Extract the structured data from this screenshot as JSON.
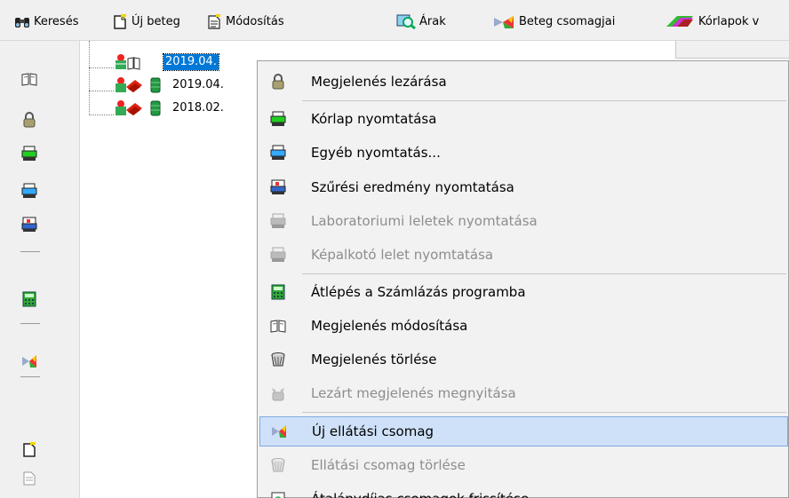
{
  "toolbar": {
    "items": [
      {
        "label": "Keresés",
        "icon": "binoculars-icon"
      },
      {
        "label": "Új beteg",
        "icon": "new-document-icon"
      },
      {
        "label": "Módosítás",
        "icon": "edit-document-icon"
      },
      {
        "label": "Árak",
        "icon": "price-search-icon"
      },
      {
        "label": "Beteg csomagjai",
        "icon": "package-icon"
      },
      {
        "label": "Kórlapok v",
        "icon": "records-icon"
      }
    ]
  },
  "tree": {
    "nodes": [
      {
        "label": "2019.04.",
        "selected": true
      },
      {
        "label": "2019.04.",
        "selected": false
      },
      {
        "label": "2018.02.",
        "selected": false
      }
    ]
  },
  "menu": {
    "items": [
      {
        "label": "Megjelenés lezárása",
        "icon": "lock-icon",
        "disabled": false
      },
      {
        "label": "Kórlap nyomtatása",
        "icon": "printer-green-icon",
        "disabled": false
      },
      {
        "label": "Egyéb nyomtatás...",
        "icon": "printer-blue-icon",
        "disabled": false
      },
      {
        "label": "Szűrési eredmény nyomtatása",
        "icon": "printer-screening-icon",
        "disabled": false
      },
      {
        "label": "Laboratoriumi leletek nyomtatása",
        "icon": "printer-gray-icon",
        "disabled": true
      },
      {
        "label": "Képalkotó lelet nyomtatása",
        "icon": "printer-gray-icon",
        "disabled": true
      },
      {
        "label": "Átlépés a Számlázás programba",
        "icon": "calculator-icon",
        "disabled": false
      },
      {
        "label": "Megjelenés módosítása",
        "icon": "book-icon",
        "disabled": false
      },
      {
        "label": "Megjelenés törlése",
        "icon": "wastebasket-icon",
        "disabled": false
      },
      {
        "label": "Lezárt megjelenés megnyitása",
        "icon": "unlock-icon",
        "disabled": true
      },
      {
        "label": "Új ellátási csomag",
        "icon": "package-icon",
        "disabled": false,
        "hover": true
      },
      {
        "label": "Ellátási csomag törlése",
        "icon": "wastebasket-icon",
        "disabled": true
      },
      {
        "label": "Átalánydíjas csomagok frissítése",
        "icon": "refresh-icon",
        "disabled": false
      }
    ]
  },
  "colors": {
    "selection": "#0078d7",
    "menu_hover": "#cfe1f8",
    "menu_bg": "#f2f2f2",
    "disabled_text": "#8d8d8d"
  }
}
